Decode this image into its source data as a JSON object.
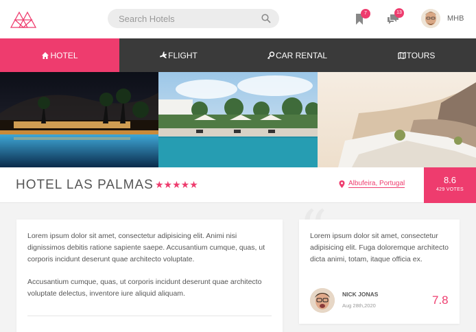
{
  "header": {
    "search_placeholder": "Search Hotels",
    "bookmarks_count": "7",
    "messages_count": "13",
    "username": "MHB"
  },
  "nav": {
    "items": [
      {
        "label": "HOTEL",
        "icon": "home-icon",
        "active": true
      },
      {
        "label": "FLIGHT",
        "icon": "plane-icon",
        "active": false
      },
      {
        "label": "CAR RENTAL",
        "icon": "key-icon",
        "active": false
      },
      {
        "label": "TOURS",
        "icon": "map-icon",
        "active": false
      }
    ]
  },
  "hotel": {
    "name": "HOTEL LAS PALMAS",
    "stars": "★★★★★",
    "location": "Albufeira, Portugal",
    "score": "8.6",
    "votes": "429 VOTES"
  },
  "description": {
    "paragraph1": "Lorem ipsum dolor sit amet, consectetur adipisicing elit. Animi nisi dignissimos debitis ratione sapiente saepe. Accusantium cumque, quas, ut corporis incidunt deserunt quae architecto voluptate.",
    "paragraph2": "Accusantium cumque, quas, ut corporis incidunt deserunt quae architecto voluptate delectus, inventore iure aliquid aliquam."
  },
  "review": {
    "text": "Lorem ipsum dolor sit amet, consectetur adipisicing elit. Fuga doloremque architecto dicta animi, totam, itaque officia ex.",
    "reviewer": "NICK JONAS",
    "date": "Aug 28th,2020",
    "score": "7.8"
  },
  "colors": {
    "accent": "#ee3c6e",
    "nav_bg": "#3a3a3a"
  }
}
